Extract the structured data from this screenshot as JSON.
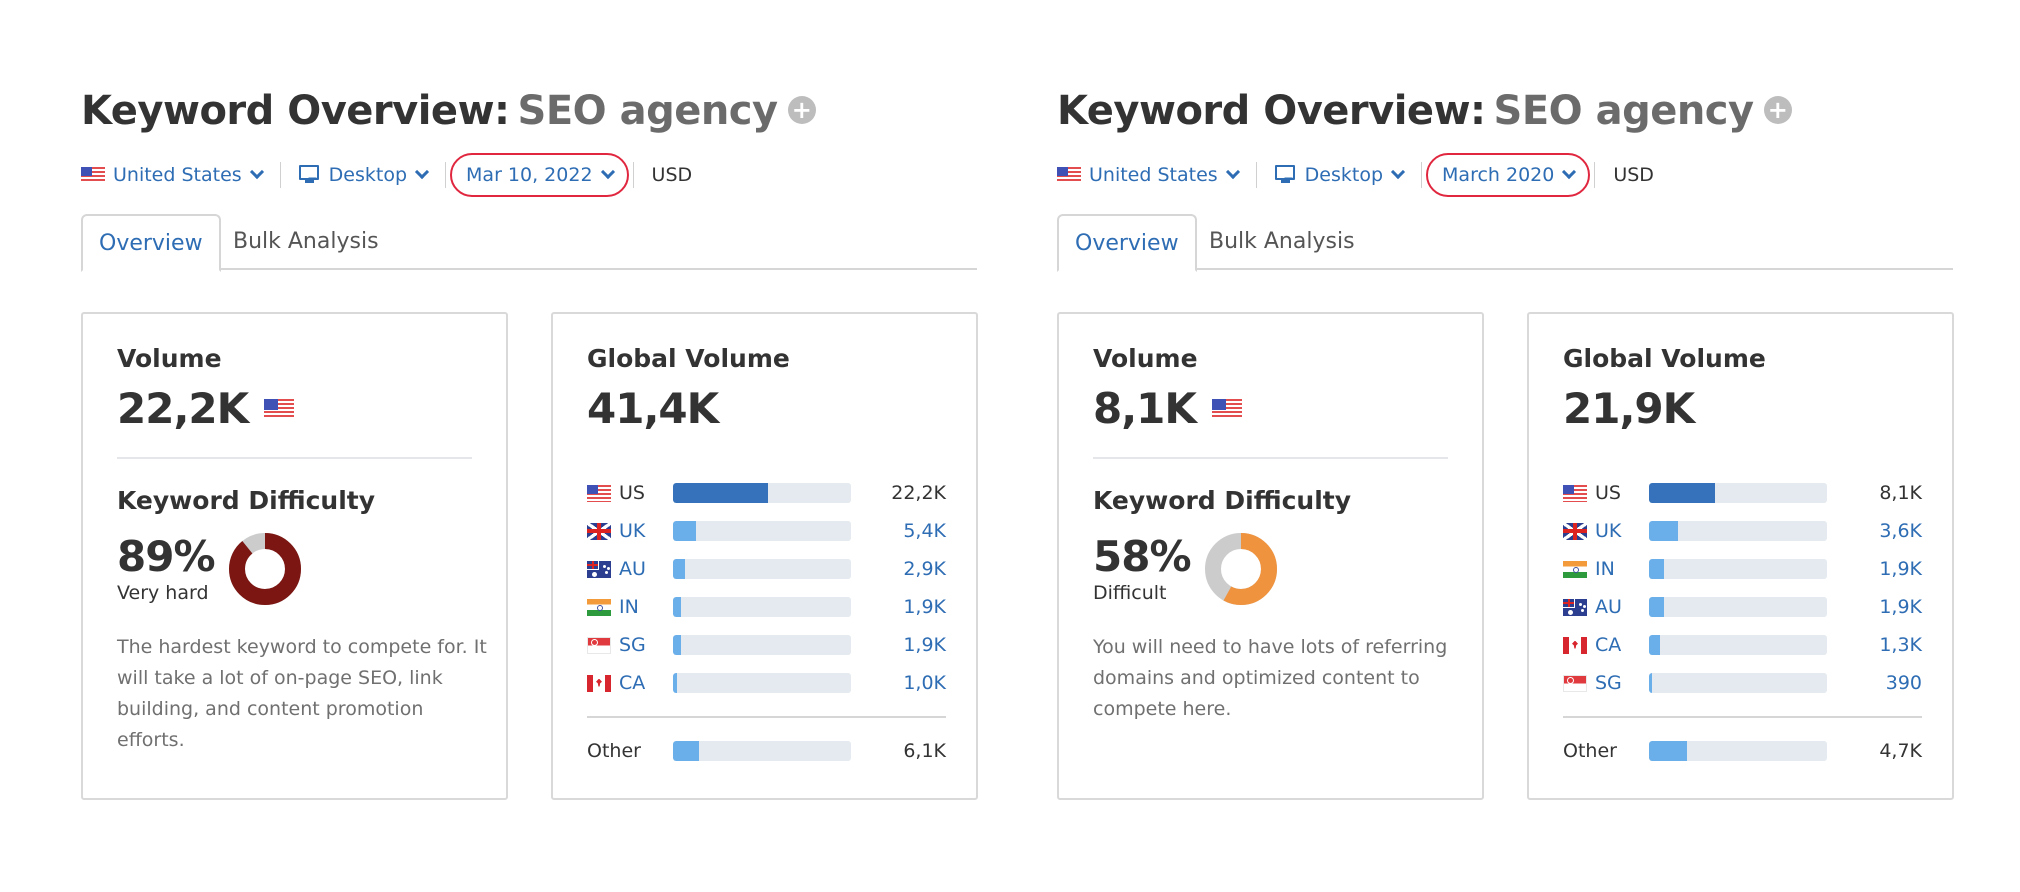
{
  "panels": [
    {
      "title_prefix": "Keyword Overview:",
      "keyword": "SEO agency",
      "add_icon": "plus-circle-icon",
      "filters": {
        "country": "United States",
        "device": "Desktop",
        "date": "Mar 10, 2022",
        "currency": "USD"
      },
      "tabs": [
        "Overview",
        "Bulk Analysis"
      ],
      "active_tab": "Overview",
      "volume": {
        "label": "Volume",
        "value": "22,2K"
      },
      "keyword_difficulty": {
        "label": "Keyword Difficulty",
        "percent_text": "89%",
        "percent": 89,
        "level": "Very hard",
        "color": "#7b1612",
        "description": "The hardest keyword to compete for. It will take a lot of on-page SEO, link building, and content promotion efforts."
      },
      "global_volume": {
        "label": "Global Volume",
        "total": "41,4K",
        "rows": [
          {
            "code": "US",
            "flag": "us",
            "value": "22,2K",
            "share": 0.536,
            "link": false
          },
          {
            "code": "UK",
            "flag": "uk",
            "value": "5,4K",
            "share": 0.13,
            "link": true
          },
          {
            "code": "AU",
            "flag": "au",
            "value": "2,9K",
            "share": 0.07,
            "link": true
          },
          {
            "code": "IN",
            "flag": "in",
            "value": "1,9K",
            "share": 0.046,
            "link": true
          },
          {
            "code": "SG",
            "flag": "sg",
            "value": "1,9K",
            "share": 0.046,
            "link": true
          },
          {
            "code": "CA",
            "flag": "ca",
            "value": "1,0K",
            "share": 0.024,
            "link": true
          }
        ],
        "other": {
          "label": "Other",
          "value": "6,1K",
          "share": 0.147
        }
      }
    },
    {
      "title_prefix": "Keyword Overview:",
      "keyword": "SEO agency",
      "add_icon": "plus-circle-icon",
      "filters": {
        "country": "United States",
        "device": "Desktop",
        "date": "March 2020",
        "currency": "USD"
      },
      "tabs": [
        "Overview",
        "Bulk Analysis"
      ],
      "active_tab": "Overview",
      "volume": {
        "label": "Volume",
        "value": "8,1K"
      },
      "keyword_difficulty": {
        "label": "Keyword Difficulty",
        "percent_text": "58%",
        "percent": 58,
        "level": "Difficult",
        "color": "#f0933e",
        "description": "You will need to have lots of referring domains and optimized content to compete here."
      },
      "global_volume": {
        "label": "Global Volume",
        "total": "21,9K",
        "rows": [
          {
            "code": "US",
            "flag": "us",
            "value": "8,1K",
            "share": 0.37,
            "link": false
          },
          {
            "code": "UK",
            "flag": "uk",
            "value": "3,6K",
            "share": 0.164,
            "link": true
          },
          {
            "code": "IN",
            "flag": "in",
            "value": "1,9K",
            "share": 0.087,
            "link": true
          },
          {
            "code": "AU",
            "flag": "au",
            "value": "1,9K",
            "share": 0.087,
            "link": true
          },
          {
            "code": "CA",
            "flag": "ca",
            "value": "1,3K",
            "share": 0.059,
            "link": true
          },
          {
            "code": "SG",
            "flag": "sg",
            "value": "390",
            "share": 0.018,
            "link": true
          }
        ],
        "other": {
          "label": "Other",
          "value": "4,7K",
          "share": 0.215
        }
      }
    }
  ],
  "colors": {
    "link": "#2e6db4",
    "bar_primary": "#3572bb",
    "bar_secondary": "#6aaeea",
    "bar_track": "#e4eaef",
    "highlight_ring": "#e0273f",
    "donut_remainder": "#cccccc"
  }
}
